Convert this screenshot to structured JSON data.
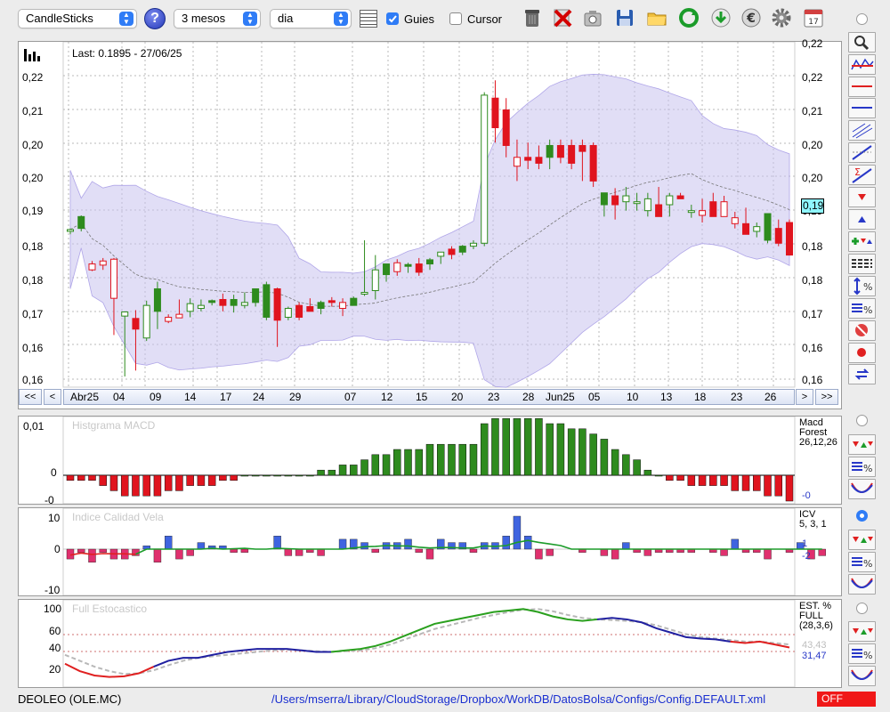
{
  "toolbar": {
    "chart_type": "CandleSticks",
    "period": "3 mesos",
    "interval": "dia",
    "guides_label": "Guies",
    "guides_checked": true,
    "cursor_label": "Cursor",
    "cursor_checked": false,
    "icons": [
      "help-icon",
      "calendar-grid-icon",
      "trash-icon",
      "delete-icon",
      "camera-icon",
      "save-icon",
      "folder-icon",
      "refresh-icon",
      "download-icon",
      "euro-icon",
      "gear-icon",
      "calendar-icon"
    ]
  },
  "main_chart": {
    "last_label": "Last: 0.1895 - 27/06/25",
    "y_ticks": [
      "0,22",
      "0,21",
      "0,20",
      "0,20",
      "0,19",
      "0,18",
      "0,18",
      "0,17",
      "0,16",
      "0,16"
    ],
    "right_y_ticks": [
      "0,22",
      "0,22",
      "0,21",
      "0,20",
      "0,20",
      "0,19",
      "0,18",
      "0,18",
      "0,17",
      "0,16",
      "0,16"
    ],
    "current_price": "0,19",
    "x_labels": [
      "Abr25",
      "04",
      "09",
      "14",
      "17",
      "24",
      "29",
      "07",
      "12",
      "15",
      "20",
      "23",
      "28",
      "Jun25",
      "05",
      "10",
      "13",
      "18",
      "23",
      "26"
    ],
    "nav": {
      "first": "<<",
      "prev": "<",
      "next": ">",
      "last": ">>"
    }
  },
  "macd": {
    "title": "Histgrama MACD",
    "y_ticks": [
      "0,01",
      "0",
      "-0"
    ],
    "right_label_1": "Macd",
    "right_label_2": "Forest",
    "right_label_3": "26,12,26",
    "right_value": "-0"
  },
  "icv": {
    "title": "Indice Calidad Vela",
    "y_ticks": [
      "10",
      "0",
      "-10"
    ],
    "right_label_1": "ICV",
    "right_label_2": "5, 3, 1",
    "right_value_1": "1",
    "right_value_2": "-2"
  },
  "stoch": {
    "title": "Full Estocastico",
    "y_ticks": [
      "100",
      "60",
      "40",
      "20"
    ],
    "right_label_1": "EST. %",
    "right_label_2": "FULL",
    "right_label_3": "(28,3,6)",
    "right_value_1": "43,43",
    "right_value_2": "31,47"
  },
  "status": {
    "ticker": "DEOLEO (OLE.MC)",
    "config_path": "/Users/mserra/Library/CloudStorage/Dropbox/WorkDB/DatosBolsa/Configs/Config.DEFAULT.xml",
    "mode": "OFF"
  },
  "colors": {
    "up": "#2e8b1e",
    "down": "#e0141e",
    "band": "#c9c2ef",
    "macd_up": "#2e8b1e",
    "macd_down": "#e0141e",
    "icv_up": "#3f64e0",
    "icv_down": "#e0306e",
    "stoch_k": "#2aa01e",
    "stoch_d": "#b8b8b8",
    "accent": "#2f7cf6"
  },
  "candles": [
    [
      0.1935,
      0.194,
      0.193,
      0.1938,
      0
    ],
    [
      0.194,
      0.1962,
      0.1935,
      0.196,
      1
    ],
    [
      0.188,
      0.1885,
      0.1868,
      0.187,
      0
    ],
    [
      0.1885,
      0.189,
      0.187,
      0.1878,
      0
    ],
    [
      0.1888,
      0.189,
      0.176,
      0.1822,
      0
    ],
    [
      0.1792,
      0.18,
      0.169,
      0.1799,
      0
    ],
    [
      0.1788,
      0.1802,
      0.17,
      0.177,
      1
    ],
    [
      0.1755,
      0.1818,
      0.175,
      0.181,
      0
    ],
    [
      0.18,
      0.185,
      0.177,
      0.1838,
      1
    ],
    [
      0.179,
      0.1795,
      0.178,
      0.1783,
      0
    ],
    [
      0.1795,
      0.182,
      0.179,
      0.1789,
      0
    ],
    [
      0.18,
      0.1822,
      0.179,
      0.1813,
      0
    ],
    [
      0.1805,
      0.182,
      0.18,
      0.181,
      0
    ],
    [
      0.1815,
      0.182,
      0.181,
      0.1818,
      1
    ],
    [
      0.182,
      0.183,
      0.18,
      0.181,
      1
    ],
    [
      0.181,
      0.1828,
      0.1798,
      0.182,
      1
    ],
    [
      0.181,
      0.1832,
      0.1805,
      0.1815,
      0
    ],
    [
      0.1815,
      0.1838,
      0.1808,
      0.1838,
      1
    ],
    [
      0.179,
      0.185,
      0.1785,
      0.1845,
      1
    ],
    [
      0.1838,
      0.184,
      0.174,
      0.1785,
      1
    ],
    [
      0.179,
      0.1808,
      0.1785,
      0.1805,
      0
    ],
    [
      0.181,
      0.1815,
      0.1785,
      0.179,
      1
    ],
    [
      0.1808,
      0.1822,
      0.18,
      0.18,
      1
    ],
    [
      0.1805,
      0.1818,
      0.1795,
      0.1815,
      1
    ],
    [
      0.1818,
      0.1824,
      0.1808,
      0.1815,
      1
    ],
    [
      0.1815,
      0.1822,
      0.1792,
      0.1805,
      0
    ],
    [
      0.181,
      0.1825,
      0.181,
      0.1822,
      1
    ],
    [
      0.183,
      0.192,
      0.1826,
      0.1832,
      0
    ],
    [
      0.1835,
      0.1895,
      0.182,
      0.187,
      0
    ],
    [
      0.1862,
      0.188,
      0.185,
      0.188,
      1
    ],
    [
      0.1882,
      0.1888,
      0.186,
      0.1867,
      0
    ],
    [
      0.1876,
      0.1882,
      0.1865,
      0.1879,
      1
    ],
    [
      0.188,
      0.189,
      0.186,
      0.1866,
      1
    ],
    [
      0.188,
      0.189,
      0.187,
      0.1887,
      1
    ],
    [
      0.1893,
      0.19,
      0.188,
      0.19,
      0
    ],
    [
      0.1905,
      0.191,
      0.1888,
      0.1896,
      1
    ],
    [
      0.19,
      0.1912,
      0.1895,
      0.191,
      1
    ],
    [
      0.191,
      0.192,
      0.1905,
      0.1915,
      0
    ],
    [
      0.1915,
      0.217,
      0.191,
      0.2165,
      0
    ],
    [
      0.216,
      0.219,
      0.2085,
      0.211,
      1
    ],
    [
      0.214,
      0.216,
      0.206,
      0.208,
      1
    ],
    [
      0.206,
      0.209,
      0.202,
      0.2045,
      0
    ],
    [
      0.206,
      0.2085,
      0.204,
      0.2055,
      1
    ],
    [
      0.206,
      0.208,
      0.204,
      0.205,
      1
    ],
    [
      0.206,
      0.209,
      0.204,
      0.208,
      1
    ],
    [
      0.208,
      0.209,
      0.205,
      0.206,
      1
    ],
    [
      0.208,
      0.209,
      0.204,
      0.205,
      1
    ],
    [
      0.208,
      0.209,
      0.202,
      0.207,
      1
    ],
    [
      0.208,
      0.2085,
      0.201,
      0.202,
      1
    ],
    [
      0.198,
      0.2,
      0.196,
      0.2,
      1
    ],
    [
      0.1995,
      0.2008,
      0.1955,
      0.198,
      1
    ],
    [
      0.1985,
      0.201,
      0.197,
      0.1995,
      0
    ],
    [
      0.1985,
      0.2,
      0.197,
      0.1985,
      0
    ],
    [
      0.197,
      0.2,
      0.196,
      0.199,
      0
    ],
    [
      0.198,
      0.201,
      0.196,
      0.196,
      1
    ],
    [
      0.198,
      0.2,
      0.196,
      0.1995,
      0
    ],
    [
      0.1995,
      0.2,
      0.199,
      0.199,
      1
    ],
    [
      0.1968,
      0.198,
      0.1958,
      0.197,
      0
    ],
    [
      0.197,
      0.199,
      0.195,
      0.1962,
      0
    ],
    [
      0.1985,
      0.2,
      0.196,
      0.196,
      1
    ],
    [
      0.1985,
      0.1995,
      0.196,
      0.196,
      0
    ],
    [
      0.1958,
      0.1968,
      0.194,
      0.1948,
      0
    ],
    [
      0.1948,
      0.1975,
      0.194,
      0.193,
      1
    ],
    [
      0.1935,
      0.195,
      0.1925,
      0.1943,
      0
    ],
    [
      0.192,
      0.196,
      0.1915,
      0.1965,
      1
    ],
    [
      0.194,
      0.1955,
      0.191,
      0.1915,
      1
    ],
    [
      0.195,
      0.1955,
      0.19,
      0.1895,
      1
    ]
  ],
  "macd_values": [
    -0.001,
    -0.001,
    -0.001,
    -0.002,
    -0.003,
    -0.004,
    -0.004,
    -0.004,
    -0.004,
    -0.003,
    -0.003,
    -0.002,
    -0.002,
    -0.002,
    -0.001,
    -0.001,
    0,
    0,
    0,
    0,
    0,
    0,
    0,
    0.001,
    0.001,
    0.002,
    0.002,
    0.003,
    0.004,
    0.004,
    0.005,
    0.005,
    0.005,
    0.006,
    0.006,
    0.006,
    0.006,
    0.006,
    0.01,
    0.011,
    0.011,
    0.011,
    0.011,
    0.011,
    0.01,
    0.01,
    0.009,
    0.009,
    0.008,
    0.007,
    0.005,
    0.004,
    0.003,
    0.001,
    0,
    -0.001,
    -0.001,
    -0.002,
    -0.002,
    -0.002,
    -0.002,
    -0.003,
    -0.003,
    -0.003,
    -0.004,
    -0.004,
    -0.005
  ],
  "icv_values": [
    -3,
    -1,
    -4,
    -1,
    -3,
    -3,
    -2,
    1,
    -4,
    4,
    -3,
    -2,
    2,
    1,
    1,
    -1,
    -1,
    0,
    0,
    4,
    -2,
    -2,
    -1,
    -2,
    0,
    3,
    3,
    2,
    -1,
    2,
    2,
    3,
    -1,
    -3,
    3,
    2,
    2,
    -1,
    2,
    2,
    4,
    10,
    4,
    -3,
    -2,
    0,
    0,
    -1,
    0,
    -2,
    -3,
    2,
    -1,
    -2,
    -1,
    -1,
    -1,
    -1,
    0,
    -1,
    -2,
    3,
    -1,
    -1,
    -3,
    0,
    -1,
    2,
    -3,
    -2
  ]
}
